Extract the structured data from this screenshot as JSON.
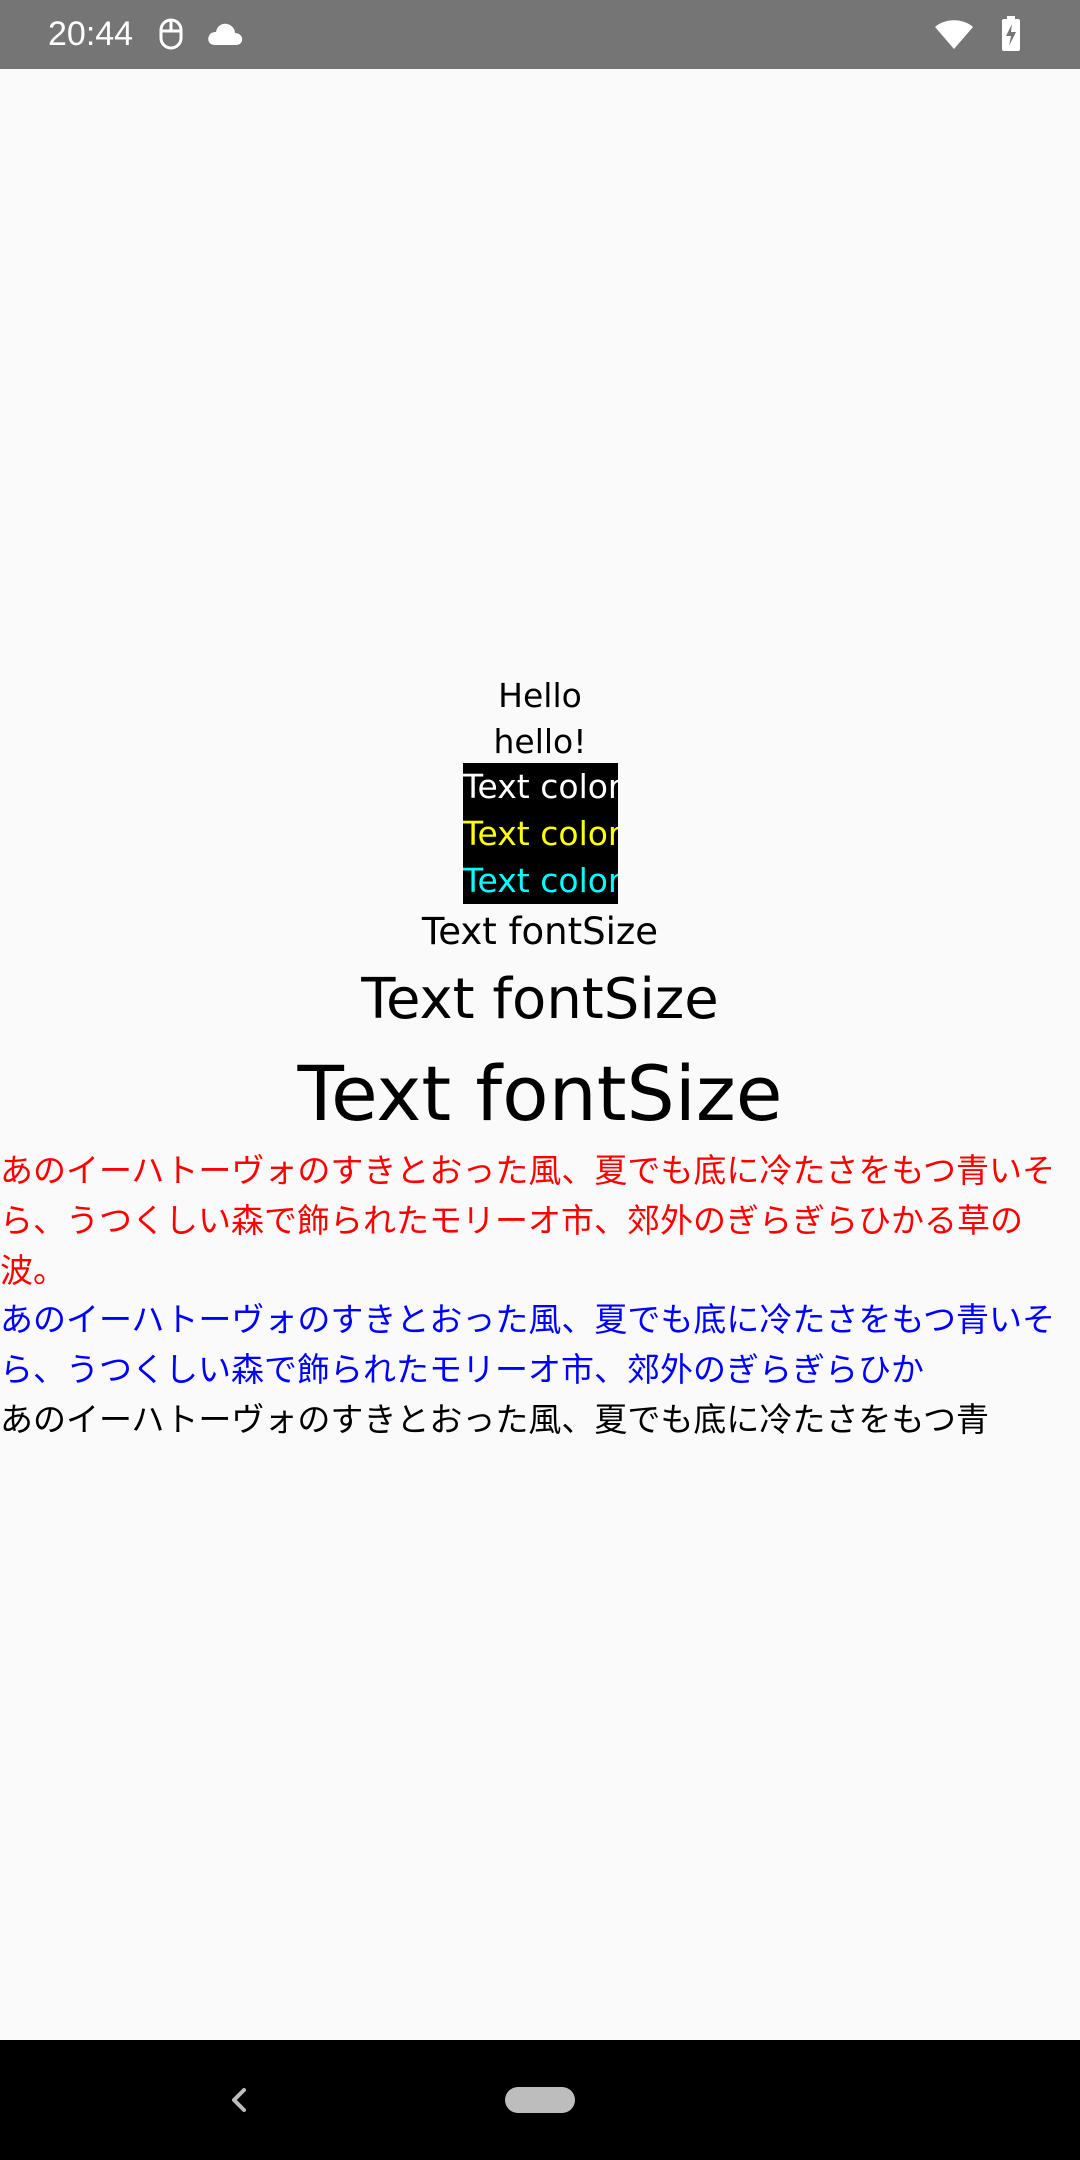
{
  "status_bar": {
    "time": "20:44",
    "left_icons": [
      "mouse-icon",
      "cloud-icon"
    ],
    "right_icons": [
      "wifi-icon",
      "battery-charging-icon"
    ]
  },
  "texts": {
    "hello": "Hello",
    "hello2": "hello!",
    "color_white": "Text color",
    "color_yellow": "Text color",
    "color_cyan": "Text color",
    "fontsize_small": "Text fontSize",
    "fontsize_medium": "Text fontSize",
    "fontsize_large": "Text fontSize",
    "jp_red": "あのイーハトーヴォのすきとおった風、夏でも底に冷たさをもつ青いそら、うつくしい森で飾られたモリーオ市、郊外のぎらぎらひかる草の波。",
    "jp_blue": "あのイーハトーヴォのすきとおった風、夏でも底に冷たさをもつ青いそら、うつくしい森で飾られたモリーオ市、郊外のぎらぎらひか",
    "jp_black": "あのイーハトーヴォのすきとおった風、夏でも底に冷たさをもつ青"
  },
  "colors": {
    "status_bar": "#757575",
    "background": "#fafafa",
    "red": "#ff0000",
    "blue": "#0000ff",
    "yellow": "#ffff00",
    "cyan": "#00ffff"
  },
  "nav_bar": {
    "back": "back-icon",
    "home": "home-pill"
  }
}
